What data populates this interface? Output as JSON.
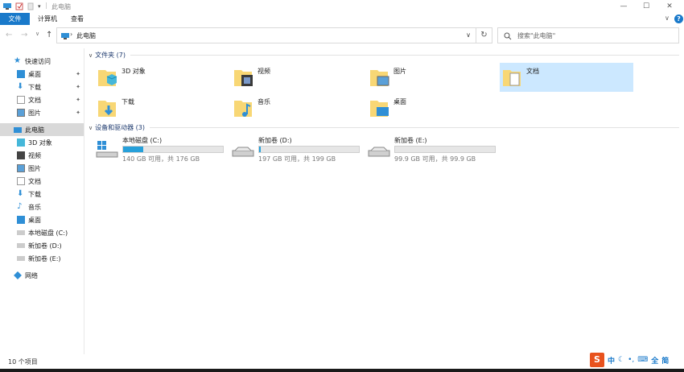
{
  "window": {
    "title": "此电脑",
    "controls": {
      "minimize": "—",
      "maximize": "☐",
      "close": "✕"
    },
    "help": "?"
  },
  "ribbon": {
    "tabs": [
      {
        "label": "文件",
        "active": true
      },
      {
        "label": "计算机"
      },
      {
        "label": "查看"
      }
    ]
  },
  "address": {
    "breadcrumb": "此电脑",
    "search_placeholder": "搜索\"此电脑\""
  },
  "sidebar": {
    "quick_access": "快速访问",
    "quick_items": [
      "桌面",
      "下载",
      "文档",
      "图片"
    ],
    "this_pc": "此电脑",
    "pc_items": [
      "3D 对象",
      "视频",
      "图片",
      "文档",
      "下载",
      "音乐",
      "桌面",
      "本地磁盘 (C:)",
      "新加卷 (D:)",
      "新加卷 (E:)"
    ],
    "network": "网络"
  },
  "folders_group": {
    "heading": "文件夹 (7)",
    "items": [
      {
        "name": "3D 对象",
        "icon": "3d-objects-icon"
      },
      {
        "name": "视频",
        "icon": "videos-icon"
      },
      {
        "name": "图片",
        "icon": "pictures-icon"
      },
      {
        "name": "文档",
        "icon": "documents-icon",
        "selected": true
      },
      {
        "name": "下载",
        "icon": "downloads-icon"
      },
      {
        "name": "音乐",
        "icon": "music-icon"
      },
      {
        "name": "桌面",
        "icon": "desktop-icon"
      }
    ]
  },
  "drives_group": {
    "heading": "设备和驱动器 (3)",
    "items": [
      {
        "name": "本地磁盘 (C:)",
        "free": "140 GB 可用，共 176 GB",
        "used_fraction": 0.2
      },
      {
        "name": "新加卷 (D:)",
        "free": "197 GB 可用，共 199 GB",
        "used_fraction": 0.01
      },
      {
        "name": "新加卷 (E:)",
        "free": "99.9 GB 可用，共 99.9 GB",
        "used_fraction": 0.0
      }
    ]
  },
  "status": {
    "count": "10 个项目"
  },
  "ime": {
    "chars": [
      "中",
      "全",
      "简"
    ]
  },
  "colors": {
    "accent": "#1979ca",
    "selected": "#cce8ff",
    "bar": "#26a0da",
    "folder": "#f8d775"
  }
}
